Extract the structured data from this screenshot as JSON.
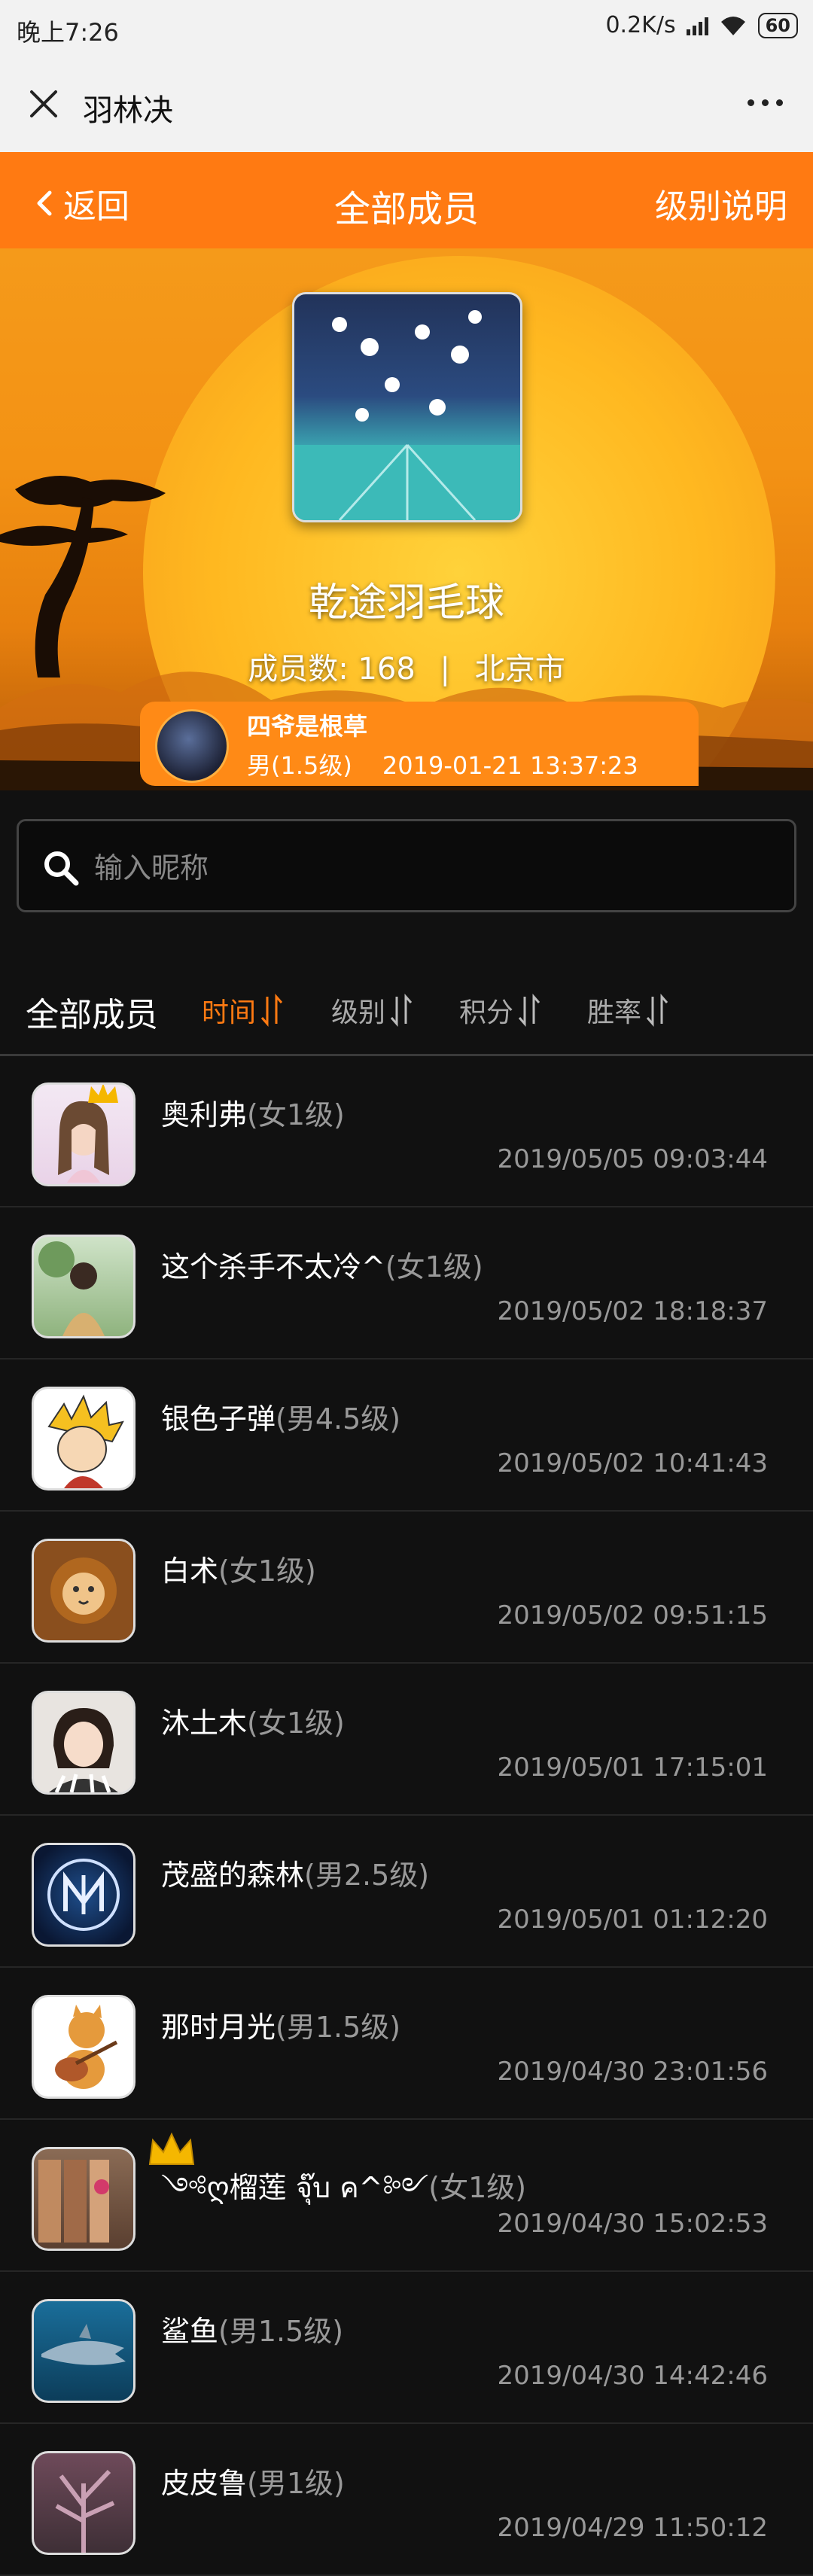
{
  "status_bar": {
    "time": "晚上7:26",
    "network_speed": "0.2K/s",
    "battery": "60"
  },
  "wechat_bar": {
    "title": "羽林决"
  },
  "nav": {
    "back_label": "返回",
    "title": "全部成员",
    "help_label": "级别说明"
  },
  "group": {
    "name": "乾途羽毛球",
    "member_count_label": "成员数: 168",
    "divider": "|",
    "city": "北京市",
    "owner": {
      "name": "四爷是根草",
      "level": "男(1.5级)",
      "joined": "2019-01-21 13:37:23"
    }
  },
  "search": {
    "placeholder": "输入昵称",
    "value": ""
  },
  "sort_bar": {
    "all_label": "全部成员",
    "items": [
      {
        "label": "时间",
        "active": true
      },
      {
        "label": "级别",
        "active": false
      },
      {
        "label": "积分",
        "active": false
      },
      {
        "label": "胜率",
        "active": false
      }
    ]
  },
  "members": [
    {
      "name": "奥利弗",
      "level": "(女1级)",
      "time": "2019/05/05 09:03:44"
    },
    {
      "name": "这个杀手不太冷^",
      "level": "(女1级)",
      "time": "2019/05/02 18:18:37"
    },
    {
      "name": "银色子弹",
      "level": "(男4.5级)",
      "time": "2019/05/02 10:41:43"
    },
    {
      "name": "白术",
      "level": "(女1级)",
      "time": "2019/05/02 09:51:15"
    },
    {
      "name": "沐土木",
      "level": "(女1级)",
      "time": "2019/05/01 17:15:01"
    },
    {
      "name": "茂盛的森林",
      "level": "(男2.5级)",
      "time": "2019/05/01 01:12:20"
    },
    {
      "name": "那时月光",
      "level": "(男1.5级)",
      "time": "2019/04/30 23:01:56"
    },
    {
      "name": "༺ღ榴莲 จุ๊บ ค^༻",
      "level": "(女1级)",
      "time": "2019/04/30 15:02:53"
    },
    {
      "name": "鲨鱼",
      "level": "(男1.5级)",
      "time": "2019/04/30 14:42:46"
    },
    {
      "name": "皮皮鲁",
      "level": "(男1级)",
      "time": "2019/04/29 11:50:12"
    }
  ],
  "colors": {
    "accent": "#ff7a12",
    "background": "#111111",
    "muted_text": "#999999"
  }
}
